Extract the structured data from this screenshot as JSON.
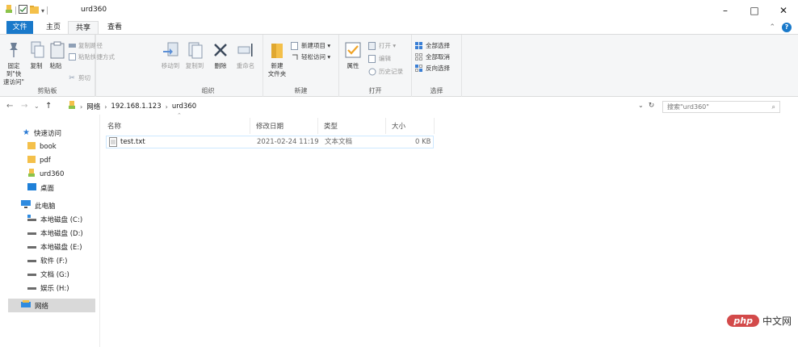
{
  "window": {
    "title": "urd360",
    "minimize": "–",
    "maximize": "□",
    "close": "✕"
  },
  "tabs": {
    "file": "文件",
    "home": "主页",
    "share": "共享",
    "view": "查看"
  },
  "ribbon": {
    "clipboard": {
      "pin": "固定到\"快\n速访问\"",
      "copy": "复制",
      "paste": "粘贴",
      "copy_path": "复制路径",
      "paste_shortcut": "粘贴快捷方式",
      "cut": "剪切",
      "label": "剪贴板"
    },
    "organize": {
      "move_to": "移动到",
      "copy_to": "复制到",
      "delete": "删除",
      "rename": "重命名",
      "label": "组织"
    },
    "new": {
      "new_folder": "新建\n文件夹",
      "new_item": "新建项目 ▾",
      "easy_access": "轻松访问 ▾",
      "label": "新建"
    },
    "open": {
      "properties": "属性",
      "open": "打开 ▾",
      "edit": "编辑",
      "history": "历史记录",
      "label": "打开"
    },
    "select": {
      "select_all": "全部选择",
      "select_none": "全部取消",
      "invert": "反向选择",
      "label": "选择"
    }
  },
  "address": {
    "segments": [
      "网络",
      "192.168.1.123",
      "urd360"
    ],
    "search_placeholder": "搜索\"urd360\""
  },
  "navpane": {
    "quick_access": "快速访问",
    "items": [
      "book",
      "pdf",
      "urd360",
      "桌面"
    ],
    "this_pc": "此电脑",
    "drives": [
      "本地磁盘 (C:)",
      "本地磁盘 (D:)",
      "本地磁盘 (E:)",
      "软件 (F:)",
      "文档 (G:)",
      "娱乐 (H:)"
    ],
    "network": "网络"
  },
  "columns": {
    "name": "名称",
    "date": "修改日期",
    "type": "类型",
    "size": "大小"
  },
  "files": [
    {
      "name": "test.txt",
      "date": "2021-02-24 11:19",
      "type": "文本文档",
      "size": "0 KB"
    }
  ],
  "watermark": {
    "logo": "php",
    "text": "中文网"
  },
  "colors": {
    "accent": "#1979ca",
    "folder": "#f4c04a",
    "ribbon_bg": "#f5f6f7"
  }
}
